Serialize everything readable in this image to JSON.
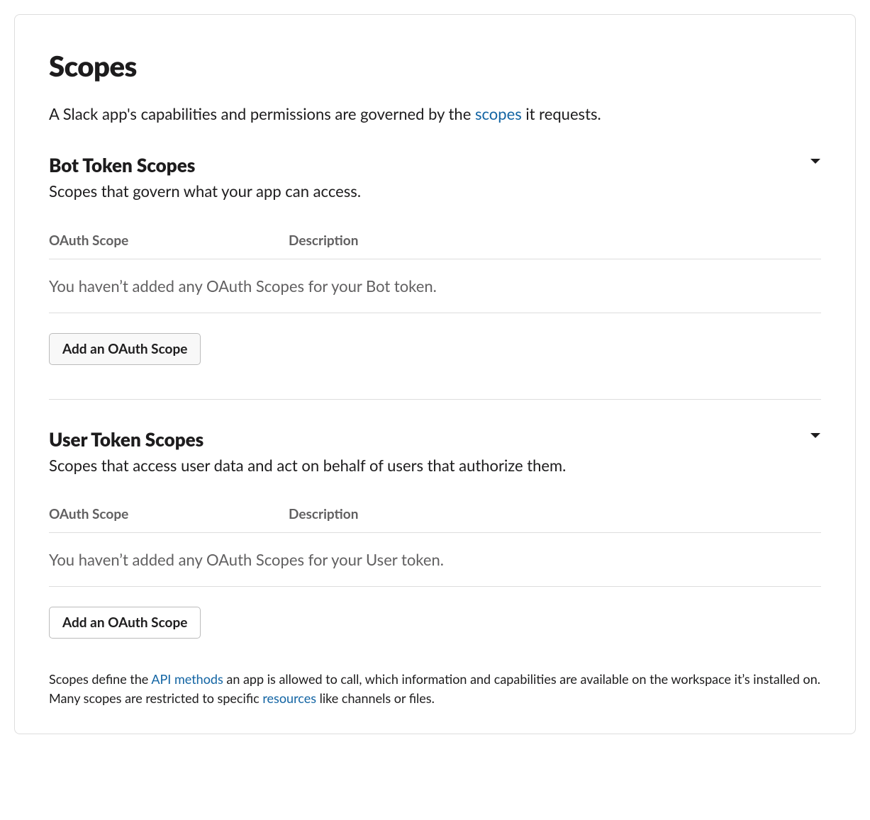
{
  "title": "Scopes",
  "intro": {
    "prefix": "A Slack app's capabilities and permissions are governed by the ",
    "link": "scopes",
    "suffix": " it requests."
  },
  "sections": {
    "bot": {
      "title": "Bot Token Scopes",
      "subtitle": "Scopes that govern what your app can access.",
      "columns": {
        "scope": "OAuth Scope",
        "description": "Description"
      },
      "empty": "You haven’t added any OAuth Scopes for your Bot token.",
      "add_button": "Add an OAuth Scope"
    },
    "user": {
      "title": "User Token Scopes",
      "subtitle": "Scopes that access user data and act on behalf of users that authorize them.",
      "columns": {
        "scope": "OAuth Scope",
        "description": "Description"
      },
      "empty": "You haven’t added any OAuth Scopes for your User token.",
      "add_button": "Add an OAuth Scope"
    }
  },
  "footer": {
    "p1": "Scopes define the ",
    "link1": "API methods",
    "p2": " an app is allowed to call, which information and capabilities are available on the workspace it’s installed on. Many scopes are restricted to specific ",
    "link2": "resources",
    "p3": " like channels or files."
  }
}
